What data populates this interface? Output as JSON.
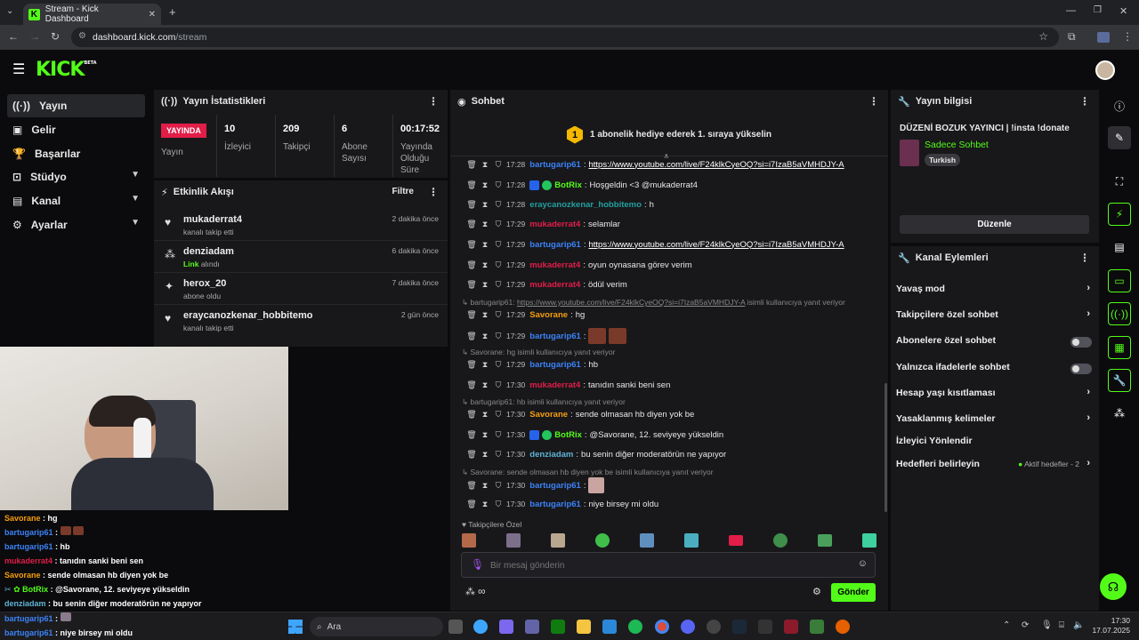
{
  "browser": {
    "tab_title": "Stream - Kick Dashboard",
    "url_host": "dashboard.kick.com",
    "url_path": "/stream"
  },
  "header": {
    "logo": "KICK",
    "beta": "BETA"
  },
  "sidebar": {
    "items": [
      {
        "label": "Yayın",
        "icon": "broadcast-icon"
      },
      {
        "label": "Gelir",
        "icon": "revenue-icon"
      },
      {
        "label": "Başarılar",
        "icon": "trophy-icon"
      },
      {
        "label": "Stüdyo",
        "icon": "studio-icon"
      },
      {
        "label": "Kanal",
        "icon": "channel-icon"
      },
      {
        "label": "Ayarlar",
        "icon": "gear-icon"
      }
    ]
  },
  "stats": {
    "title": "Yayın İstatistikleri",
    "live_badge": "YAYINDA",
    "live_label": "Yayın",
    "items": [
      {
        "value": "10",
        "label": "İzleyici"
      },
      {
        "value": "209",
        "label": "Takipçi"
      },
      {
        "value": "6",
        "label": "Abone Sayısı"
      },
      {
        "value": "00:17:52",
        "label": "Yayında Olduğu Süre"
      }
    ]
  },
  "activity": {
    "title": "Etkinlik Akışı",
    "filter": "Filtre",
    "items": [
      {
        "name": "mukaderrat4",
        "desc": "kanalı takip etti",
        "time": "2 dakika önce"
      },
      {
        "name": "denziadam",
        "link": "Link",
        "desc": "alındı",
        "time": "6 dakika önce"
      },
      {
        "name": "herox_20",
        "desc": "abone oldu",
        "time": "7 dakika önce"
      },
      {
        "name": "eraycanozkenar_hobbitemo",
        "desc": "kanalı takip etti",
        "time": "2 gün önce"
      }
    ]
  },
  "chat": {
    "title": "Sohbet",
    "pinned_num": "1",
    "pinned": "1 abonelik hediye ederek 1. sıraya yükselin",
    "messages": [
      {
        "time": "17:28",
        "user": "bartugarip61",
        "text": "https://www.youtube.com/live/F24klkCyeOQ?si=i7IzaB5aVMHDJY-A"
      },
      {
        "time": "17:28",
        "user": "BotRix",
        "text": "Hoşgeldin <3 @mukaderrat4"
      },
      {
        "time": "17:28",
        "user": "eraycanozkenar_hobbitemo",
        "text": "h"
      },
      {
        "time": "17:29",
        "user": "mukaderrat4",
        "text": "selamlar"
      },
      {
        "time": "17:29",
        "user": "bartugarip61",
        "text": "https://www.youtube.com/live/F24klkCyeOQ?si=i7IzaB5aVMHDJY-A"
      },
      {
        "time": "17:29",
        "user": "mukaderrat4",
        "text": "oyun oynasana görev verim"
      },
      {
        "time": "17:29",
        "user": "mukaderrat4",
        "text": "ödül verim"
      },
      {
        "time": "17:29",
        "user": "Savorane",
        "text": "hg"
      },
      {
        "time": "17:29",
        "user": "bartugarip61",
        "text": ""
      },
      {
        "time": "17:29",
        "user": "bartugarip61",
        "text": "hb"
      },
      {
        "time": "17:30",
        "user": "mukaderrat4",
        "text": "tanıdın sanki beni sen"
      },
      {
        "time": "17:30",
        "user": "Savorane",
        "text": "sende olmasan hb diyen yok be"
      },
      {
        "time": "17:30",
        "user": "BotRix",
        "text": "@Savorane, 12. seviyeye yükseldin"
      },
      {
        "time": "17:30",
        "user": "denziadam",
        "text": "bu senin diğer moderatörün ne yapıyor"
      },
      {
        "time": "17:30",
        "user": "bartugarip61",
        "text": ""
      },
      {
        "time": "17:30",
        "user": "bartugarip61",
        "text": "niye birsey mi oldu"
      }
    ],
    "replies": [
      {
        "prefix": "bartugarip61: ",
        "link": "https://www.youtube.com/live/F24klkCyeOQ?si=i7IzaB5aVMHDJY-A",
        "suffix": " isimli kullanıcıya yanıt veriyor"
      },
      {
        "text": "Savorane: hg isimli kullanıcıya yanıt veriyor"
      },
      {
        "text": "bartugarip61: hb isimli kullanıcıya yanıt veriyor"
      },
      {
        "text": "Savorane: sende olmasan hb diyen yok be isimli kullanıcıya yanıt veriyor"
      }
    ],
    "emote_label": "Takipçilere Özel",
    "input_placeholder": "Bir mesaj gönderin",
    "send": "Gönder"
  },
  "info": {
    "title": "Yayın bilgisi",
    "stream_title": "DÜZENİ BOZUK YAYINCI | !insta !donate",
    "category": "Sadece Sohbet",
    "tag": "Turkish",
    "edit": "Düzenle"
  },
  "channel_actions": {
    "title": "Kanal Eylemleri",
    "items": [
      {
        "label": "Yavaş mod",
        "kind": "arrow"
      },
      {
        "label": "Takipçilere özel sohbet",
        "kind": "arrow"
      },
      {
        "label": "Abonelere özel sohbet",
        "kind": "toggle"
      },
      {
        "label": "Yalnızca ifadelerle sohbet",
        "kind": "toggle"
      },
      {
        "label": "Hesap yaşı kısıtlaması",
        "kind": "arrow"
      },
      {
        "label": "Yasaklanmış kelimeler",
        "kind": "arrow"
      },
      {
        "label": "İzleyici Yönlendir",
        "kind": "none"
      },
      {
        "label": "Hedefleri belirleyin",
        "kind": "arrow",
        "extra": "Aktif hedefler - 2"
      }
    ]
  },
  "overlay_chat": [
    {
      "user": "Savorane",
      "text": " : hg"
    },
    {
      "user": "bartugarip61",
      "text": " :"
    },
    {
      "user": "bartugarip61",
      "text": " : hb"
    },
    {
      "user": "mukaderrat4",
      "text": " : tanıdın sanki beni sen"
    },
    {
      "user": "Savorane",
      "text": " : sende olmasan hb diyen yok be"
    },
    {
      "user": "BotRix",
      "text": " : @Savorane, 12. seviyeye yükseldin"
    },
    {
      "user": "denziadam",
      "text": " : bu senin diğer moderatörün ne yapıyor"
    },
    {
      "user": "bartugarip61",
      "text": " :"
    },
    {
      "user": "bartugarip61",
      "text": " : niye birsey mi oldu"
    }
  ],
  "taskbar": {
    "search": "Ara",
    "time": "17:30",
    "date": "17.07.2025"
  },
  "colors": {
    "accent": "#53fc18",
    "live": "#e11d48",
    "panel": "#18181b"
  }
}
